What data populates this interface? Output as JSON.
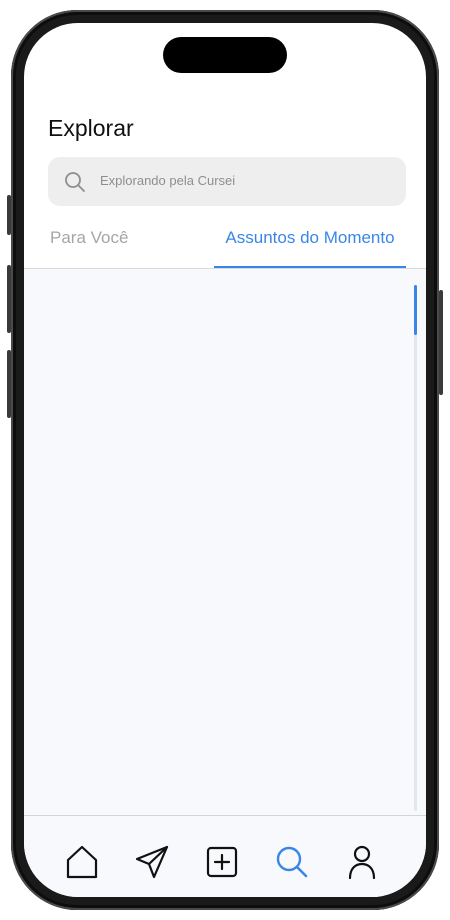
{
  "header": {
    "title": "Explorar"
  },
  "search": {
    "placeholder": "Explorando pela Cursei",
    "icon": "search-icon"
  },
  "tabs": [
    {
      "label": "Para Você",
      "active": false
    },
    {
      "label": "Assuntos do Momento",
      "active": true
    }
  ],
  "colors": {
    "accent": "#3a86e8",
    "inactive_text": "#a6a6a6",
    "icon": "#111111"
  },
  "bottom_nav": [
    {
      "icon": "home-icon",
      "active": false
    },
    {
      "icon": "send-icon",
      "active": false
    },
    {
      "icon": "add-post-icon",
      "active": false
    },
    {
      "icon": "search-icon",
      "active": true
    },
    {
      "icon": "profile-icon",
      "active": false
    }
  ]
}
